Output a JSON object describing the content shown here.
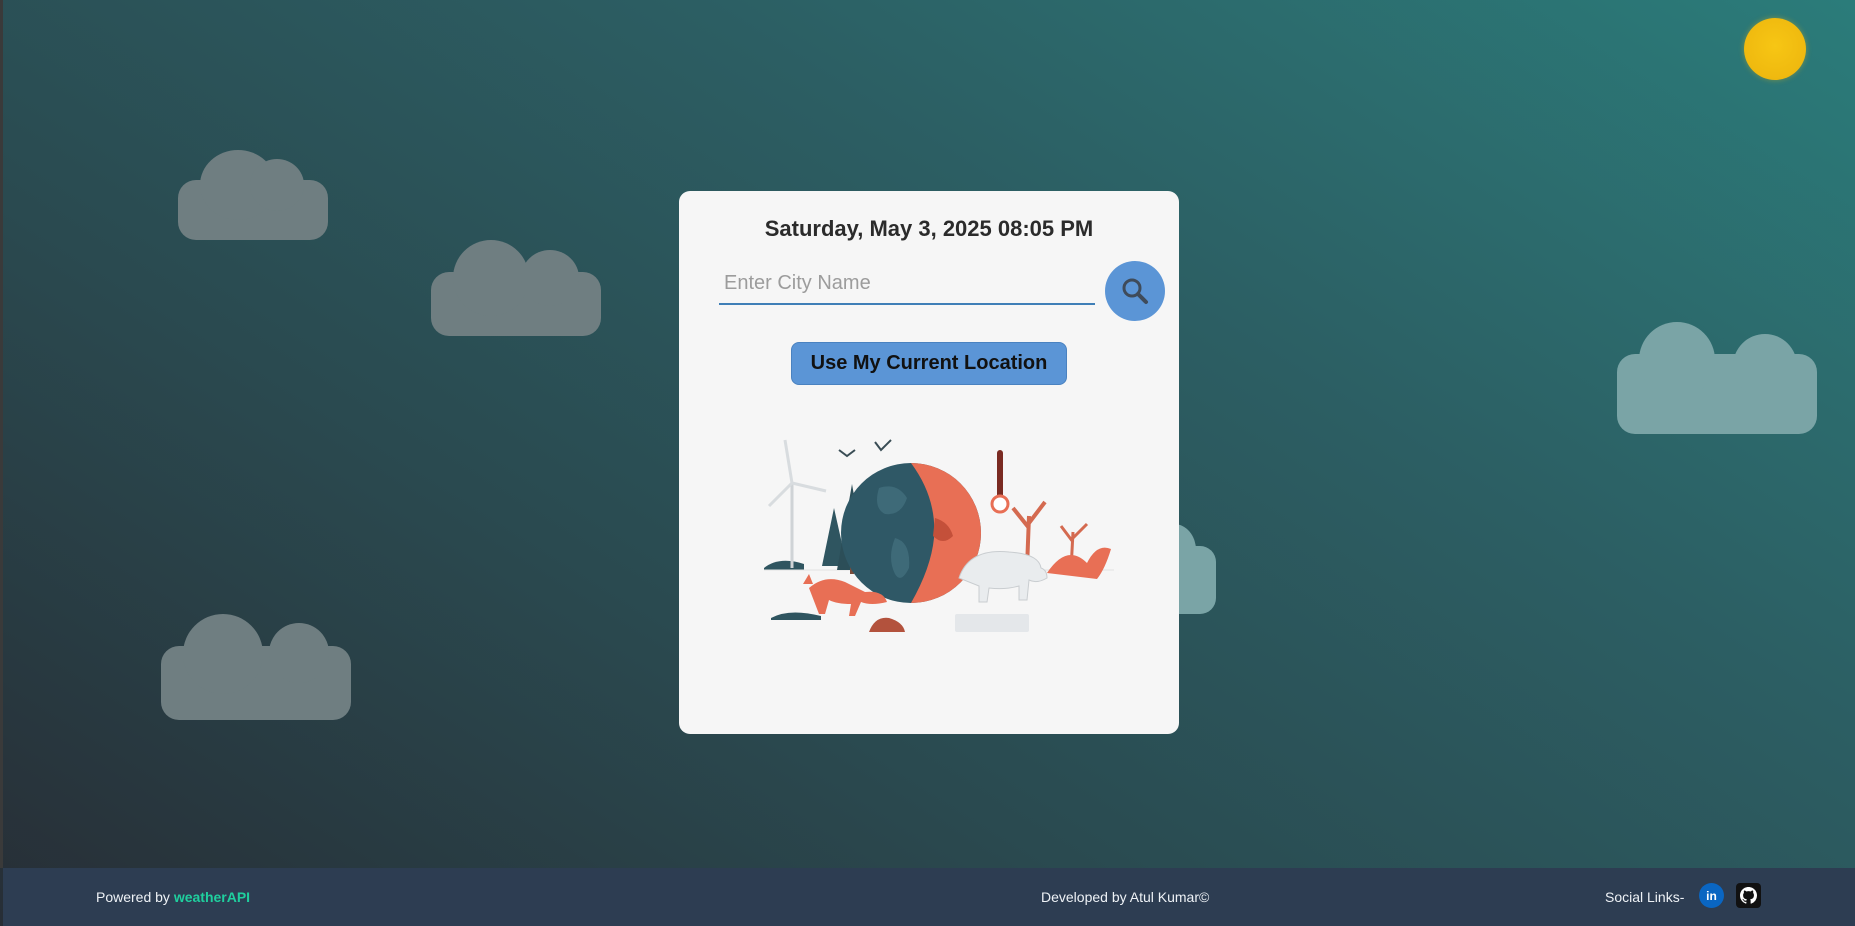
{
  "card": {
    "datetime": "Saturday, May 3, 2025 08:05 PM",
    "search": {
      "placeholder": "Enter City Name",
      "button_icon": "search-icon"
    },
    "location_button_label": "Use My Current Location",
    "illustration": "climate-change-illustration"
  },
  "footer": {
    "powered_prefix": "Powered by",
    "powered_link": "weatherAPI",
    "developer": "Developed by Atul Kumar©",
    "social_label": "Social Links-",
    "social_links": [
      {
        "icon": "linkedin-icon",
        "text": "in"
      },
      {
        "icon": "github-icon"
      }
    ]
  },
  "colors": {
    "accent": "#5b95d6",
    "footer_bg": "#2d3d52",
    "brand_link": "#1fcf9e",
    "sun": "#f2bf12"
  }
}
